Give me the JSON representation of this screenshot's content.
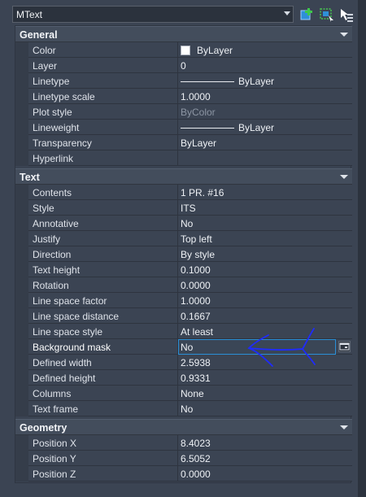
{
  "selector": {
    "value": "MText"
  },
  "toolbar": {
    "icons": [
      "add-selected-icon",
      "quick-select-icon",
      "select-objects-icon"
    ]
  },
  "colors": {
    "highlight_border": "#2a8fd6",
    "annotation": "#1f2bff"
  },
  "sections": {
    "general": {
      "title": "General",
      "rows": {
        "color": {
          "label": "Color",
          "value": "ByLayer"
        },
        "layer": {
          "label": "Layer",
          "value": "0"
        },
        "linetype": {
          "label": "Linetype",
          "value": "ByLayer"
        },
        "linetype_scale": {
          "label": "Linetype scale",
          "value": "1.0000"
        },
        "plot_style": {
          "label": "Plot style",
          "value": "ByColor"
        },
        "lineweight": {
          "label": "Lineweight",
          "value": "ByLayer"
        },
        "transparency": {
          "label": "Transparency",
          "value": "ByLayer"
        },
        "hyperlink": {
          "label": "Hyperlink",
          "value": ""
        }
      }
    },
    "text": {
      "title": "Text",
      "rows": {
        "contents": {
          "label": "Contents",
          "value": "1 PR. #16"
        },
        "style": {
          "label": "Style",
          "value": "ITS"
        },
        "annotative": {
          "label": "Annotative",
          "value": "No"
        },
        "justify": {
          "label": "Justify",
          "value": "Top left"
        },
        "direction": {
          "label": "Direction",
          "value": "By style"
        },
        "text_height": {
          "label": "Text height",
          "value": "0.1000"
        },
        "rotation": {
          "label": "Rotation",
          "value": "0.0000"
        },
        "line_space_factor": {
          "label": "Line space factor",
          "value": "1.0000"
        },
        "line_space_distance": {
          "label": "Line space distance",
          "value": "0.1667"
        },
        "line_space_style": {
          "label": "Line space style",
          "value": "At least"
        },
        "background_mask": {
          "label": "Background mask",
          "value": "No"
        },
        "defined_width": {
          "label": "Defined width",
          "value": "2.5938"
        },
        "defined_height": {
          "label": "Defined height",
          "value": "0.9331"
        },
        "columns": {
          "label": "Columns",
          "value": "None"
        },
        "text_frame": {
          "label": "Text frame",
          "value": "No"
        }
      }
    },
    "geometry": {
      "title": "Geometry",
      "rows": {
        "position_x": {
          "label": "Position X",
          "value": "8.4023"
        },
        "position_y": {
          "label": "Position Y",
          "value": "6.5052"
        },
        "position_z": {
          "label": "Position Z",
          "value": "0.0000"
        }
      }
    }
  }
}
